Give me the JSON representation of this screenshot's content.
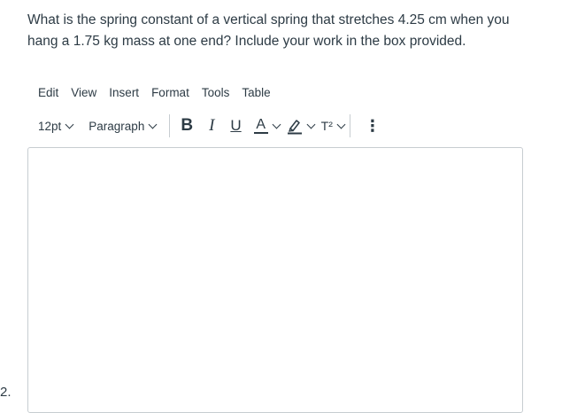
{
  "question": {
    "line1": "What is the spring constant of a vertical spring that stretches 4.25 cm when you",
    "line2": "hang a 1.75 kg mass at one end?  Include your work in the box provided."
  },
  "menubar": {
    "edit": "Edit",
    "view": "View",
    "insert": "Insert",
    "format": "Format",
    "tools": "Tools",
    "table": "Table"
  },
  "toolbar": {
    "font_size": "12pt",
    "block_format": "Paragraph",
    "bold": "B",
    "italic": "I",
    "underline": "U",
    "text_color": "A",
    "superscript": "T²",
    "more": "⋮"
  },
  "editor": {
    "content": ""
  },
  "question_number": "2."
}
